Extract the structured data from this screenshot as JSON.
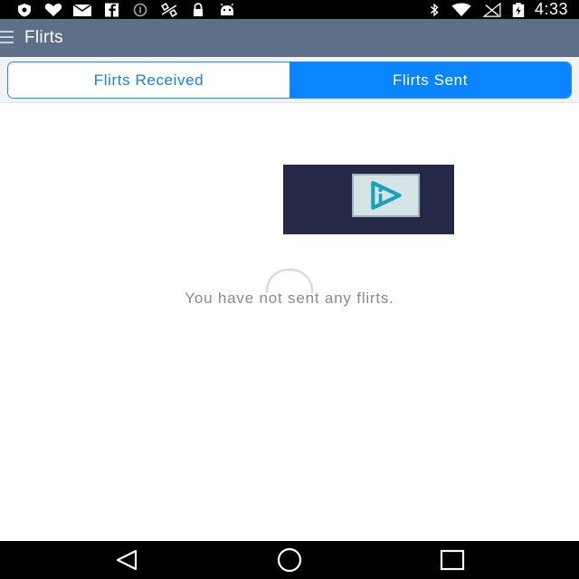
{
  "status_bar": {
    "time": "4:33",
    "icons_left": [
      "shield-icon",
      "heart-icon",
      "mail-icon",
      "facebook-icon",
      "info-circle-icon",
      "satellite-icon",
      "lock-icon",
      "android-icon"
    ],
    "icons_right": [
      "bluetooth-icon",
      "wifi-icon",
      "signal-icon",
      "battery-charging-icon"
    ]
  },
  "action_bar": {
    "title": "Flirts",
    "color": "#5e7088"
  },
  "tabs": [
    {
      "label": "Flirts Received",
      "selected": false
    },
    {
      "label": "Flirts Sent",
      "selected": true
    }
  ],
  "accent_color": "#0a84ff",
  "content": {
    "empty_message": "You have not sent any flirts."
  },
  "nav_bar": {
    "buttons": [
      "back",
      "home",
      "recent-apps"
    ]
  }
}
